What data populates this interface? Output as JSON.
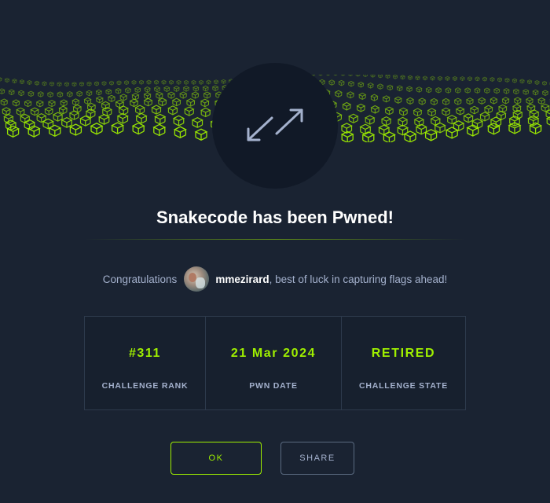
{
  "modal": {
    "title": "Snakecode has been Pwned!",
    "badge_icon": "expand-arrows-icon",
    "congrats": {
      "prefix": "Congratulations",
      "username": "mmezirard",
      "suffix": ", best of luck in capturing flags ahead!"
    },
    "stats": [
      {
        "value": "#311",
        "label": "CHALLENGE RANK"
      },
      {
        "value": "21 Mar 2024",
        "label": "PWN DATE"
      },
      {
        "value": "RETIRED",
        "label": "CHALLENGE STATE"
      }
    ],
    "buttons": {
      "ok": "OK",
      "share": "SHARE"
    }
  },
  "colors": {
    "background": "#1a2332",
    "accent": "#9fef00",
    "muted": "#a4b1cd",
    "badge_bg": "#111927"
  }
}
